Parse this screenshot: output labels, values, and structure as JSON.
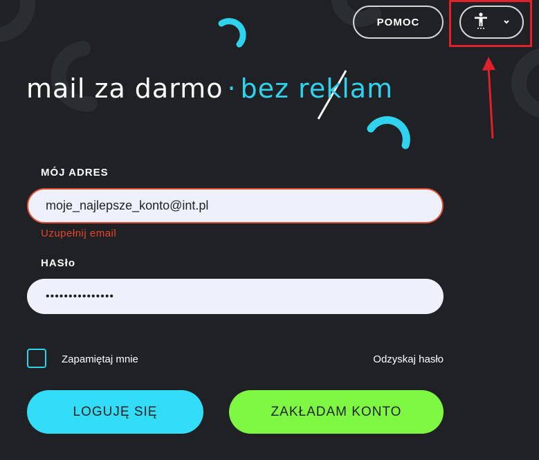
{
  "header": {
    "help_label": "POMOC",
    "accessibility_icon": "accessibility-person-icon",
    "chevron_icon": "chevron-down-icon"
  },
  "logo": {
    "part1": "mail za darmo",
    "separator": "·",
    "part2": "bez reklam"
  },
  "form": {
    "address_label": "MÓJ ADRES",
    "email_value": "moje_najlepsze_konto@int.pl",
    "email_error": "Uzupełnij email",
    "password_label": "HASło",
    "password_value": "•••••••••••••••",
    "remember_label": "Zapamiętaj mnie",
    "recover_label": "Odzyskaj hasło",
    "login_label": "LOGUJĘ SIĘ",
    "register_label": "ZAKŁADAM KONTO"
  },
  "colors": {
    "background": "#1f2125",
    "accent_cyan": "#33dcf7",
    "accent_green": "#7ef843",
    "error": "#e8452c",
    "highlight": "#e0202a"
  }
}
